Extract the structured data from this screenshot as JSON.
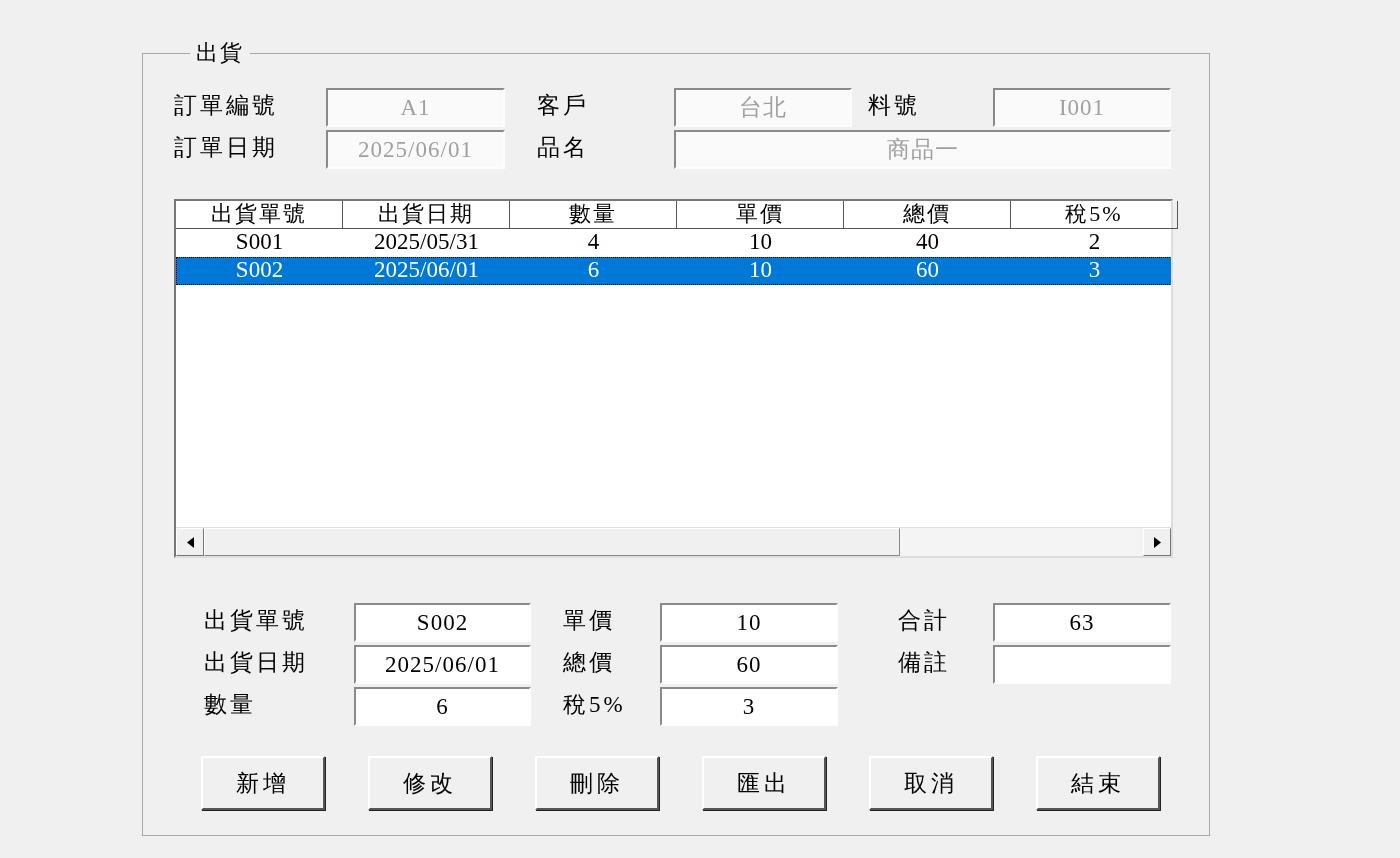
{
  "group": {
    "title": "出貨"
  },
  "order_fields": [
    [
      {
        "label": "訂單編號",
        "value": "A1",
        "disabled": true
      },
      {
        "label": "客戶",
        "value": "台北",
        "disabled": true
      },
      {
        "label": "料號",
        "value": "I001",
        "disabled": true
      }
    ],
    [
      {
        "label": "訂單日期",
        "value": "2025/06/01",
        "disabled": true
      },
      {
        "label": "品名",
        "value": "商品一",
        "disabled": true
      }
    ]
  ],
  "table": {
    "columns": [
      "出貨單號",
      "出貨日期",
      "數量",
      "單價",
      "總價",
      "稅5%"
    ],
    "rows": [
      {
        "cells": [
          "S001",
          "2025/05/31",
          "4",
          "10",
          "40",
          "2"
        ],
        "selected": false
      },
      {
        "cells": [
          "S002",
          "2025/06/01",
          "6",
          "10",
          "60",
          "3"
        ],
        "selected": true
      }
    ]
  },
  "detail_fields": [
    [
      {
        "label": "出貨單號",
        "value": "S002"
      },
      {
        "label": "單價",
        "value": "10"
      },
      {
        "label": "合計",
        "value": "63"
      }
    ],
    [
      {
        "label": "出貨日期",
        "value": "2025/06/01"
      },
      {
        "label": "總價",
        "value": "60"
      },
      {
        "label": "備註"
      }
    ],
    [
      {
        "label": "數量",
        "value": "6"
      },
      {
        "label": "稅5%",
        "value": "3"
      }
    ]
  ],
  "buttons": [
    "新增",
    "修改",
    "刪除",
    "匯出",
    "取消",
    "結束"
  ]
}
